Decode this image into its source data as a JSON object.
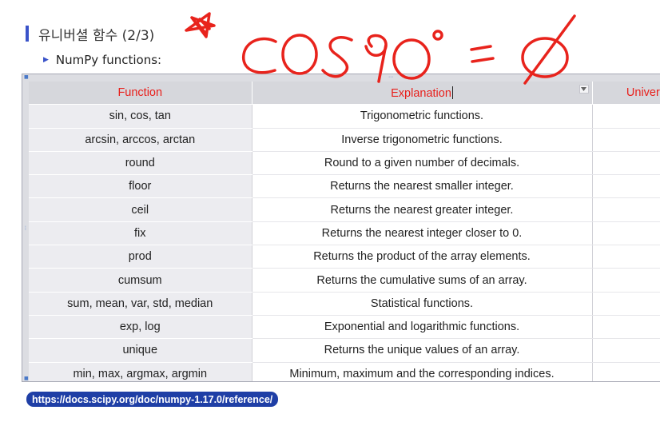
{
  "slide": {
    "title": "유니버셜 함수 (2/3)",
    "bullet": "NumPy functions:"
  },
  "table": {
    "headers": [
      "Function",
      "Explanation",
      "Univers"
    ],
    "rows": [
      {
        "function": "sin, cos, tan",
        "explanation": "Trigonometric functions."
      },
      {
        "function": "arcsin, arccos, arctan",
        "explanation": "Inverse trigonometric functions."
      },
      {
        "function": "round",
        "explanation": "Round to a given number of decimals."
      },
      {
        "function": "floor",
        "explanation": "Returns the nearest smaller integer."
      },
      {
        "function": "ceil",
        "explanation": "Returns the nearest greater integer."
      },
      {
        "function": "fix",
        "explanation": "Returns the nearest integer closer to 0."
      },
      {
        "function": "prod",
        "explanation": "Returns the product of the array elements."
      },
      {
        "function": "cumsum",
        "explanation": "Returns the cumulative sums of an array."
      },
      {
        "function": "sum, mean, var, std, median",
        "explanation": "Statistical functions."
      },
      {
        "function": "exp, log",
        "explanation": "Exponential and logarithmic functions."
      },
      {
        "function": "unique",
        "explanation": "Returns the unique values of an array."
      },
      {
        "function": "min, max, argmax, argmin",
        "explanation": "Minimum, maximum and the corresponding indices."
      }
    ]
  },
  "link": {
    "url": "https://docs.scipy.org/doc/numpy-1.17.0/reference/"
  },
  "annotation": {
    "handwriting": "cos90° = Ø",
    "ink_color": "#e8231c"
  },
  "colors": {
    "accent": "#3a53c9",
    "header_text": "#e8201c",
    "link_pill": "#1f3fa6"
  }
}
